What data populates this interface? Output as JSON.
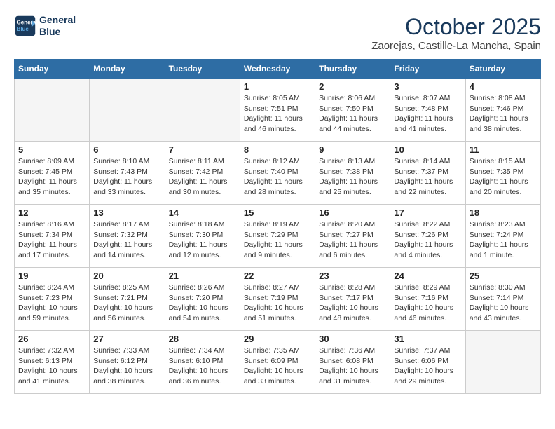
{
  "logo": {
    "line1": "General",
    "line2": "Blue"
  },
  "title": "October 2025",
  "subtitle": "Zaorejas, Castille-La Mancha, Spain",
  "weekdays": [
    "Sunday",
    "Monday",
    "Tuesday",
    "Wednesday",
    "Thursday",
    "Friday",
    "Saturday"
  ],
  "weeks": [
    [
      {
        "day": "",
        "info": ""
      },
      {
        "day": "",
        "info": ""
      },
      {
        "day": "",
        "info": ""
      },
      {
        "day": "1",
        "info": "Sunrise: 8:05 AM\nSunset: 7:51 PM\nDaylight: 11 hours and 46 minutes."
      },
      {
        "day": "2",
        "info": "Sunrise: 8:06 AM\nSunset: 7:50 PM\nDaylight: 11 hours and 44 minutes."
      },
      {
        "day": "3",
        "info": "Sunrise: 8:07 AM\nSunset: 7:48 PM\nDaylight: 11 hours and 41 minutes."
      },
      {
        "day": "4",
        "info": "Sunrise: 8:08 AM\nSunset: 7:46 PM\nDaylight: 11 hours and 38 minutes."
      }
    ],
    [
      {
        "day": "5",
        "info": "Sunrise: 8:09 AM\nSunset: 7:45 PM\nDaylight: 11 hours and 35 minutes."
      },
      {
        "day": "6",
        "info": "Sunrise: 8:10 AM\nSunset: 7:43 PM\nDaylight: 11 hours and 33 minutes."
      },
      {
        "day": "7",
        "info": "Sunrise: 8:11 AM\nSunset: 7:42 PM\nDaylight: 11 hours and 30 minutes."
      },
      {
        "day": "8",
        "info": "Sunrise: 8:12 AM\nSunset: 7:40 PM\nDaylight: 11 hours and 28 minutes."
      },
      {
        "day": "9",
        "info": "Sunrise: 8:13 AM\nSunset: 7:38 PM\nDaylight: 11 hours and 25 minutes."
      },
      {
        "day": "10",
        "info": "Sunrise: 8:14 AM\nSunset: 7:37 PM\nDaylight: 11 hours and 22 minutes."
      },
      {
        "day": "11",
        "info": "Sunrise: 8:15 AM\nSunset: 7:35 PM\nDaylight: 11 hours and 20 minutes."
      }
    ],
    [
      {
        "day": "12",
        "info": "Sunrise: 8:16 AM\nSunset: 7:34 PM\nDaylight: 11 hours and 17 minutes."
      },
      {
        "day": "13",
        "info": "Sunrise: 8:17 AM\nSunset: 7:32 PM\nDaylight: 11 hours and 14 minutes."
      },
      {
        "day": "14",
        "info": "Sunrise: 8:18 AM\nSunset: 7:30 PM\nDaylight: 11 hours and 12 minutes."
      },
      {
        "day": "15",
        "info": "Sunrise: 8:19 AM\nSunset: 7:29 PM\nDaylight: 11 hours and 9 minutes."
      },
      {
        "day": "16",
        "info": "Sunrise: 8:20 AM\nSunset: 7:27 PM\nDaylight: 11 hours and 6 minutes."
      },
      {
        "day": "17",
        "info": "Sunrise: 8:22 AM\nSunset: 7:26 PM\nDaylight: 11 hours and 4 minutes."
      },
      {
        "day": "18",
        "info": "Sunrise: 8:23 AM\nSunset: 7:24 PM\nDaylight: 11 hours and 1 minute."
      }
    ],
    [
      {
        "day": "19",
        "info": "Sunrise: 8:24 AM\nSunset: 7:23 PM\nDaylight: 10 hours and 59 minutes."
      },
      {
        "day": "20",
        "info": "Sunrise: 8:25 AM\nSunset: 7:21 PM\nDaylight: 10 hours and 56 minutes."
      },
      {
        "day": "21",
        "info": "Sunrise: 8:26 AM\nSunset: 7:20 PM\nDaylight: 10 hours and 54 minutes."
      },
      {
        "day": "22",
        "info": "Sunrise: 8:27 AM\nSunset: 7:19 PM\nDaylight: 10 hours and 51 minutes."
      },
      {
        "day": "23",
        "info": "Sunrise: 8:28 AM\nSunset: 7:17 PM\nDaylight: 10 hours and 48 minutes."
      },
      {
        "day": "24",
        "info": "Sunrise: 8:29 AM\nSunset: 7:16 PM\nDaylight: 10 hours and 46 minutes."
      },
      {
        "day": "25",
        "info": "Sunrise: 8:30 AM\nSunset: 7:14 PM\nDaylight: 10 hours and 43 minutes."
      }
    ],
    [
      {
        "day": "26",
        "info": "Sunrise: 7:32 AM\nSunset: 6:13 PM\nDaylight: 10 hours and 41 minutes."
      },
      {
        "day": "27",
        "info": "Sunrise: 7:33 AM\nSunset: 6:12 PM\nDaylight: 10 hours and 38 minutes."
      },
      {
        "day": "28",
        "info": "Sunrise: 7:34 AM\nSunset: 6:10 PM\nDaylight: 10 hours and 36 minutes."
      },
      {
        "day": "29",
        "info": "Sunrise: 7:35 AM\nSunset: 6:09 PM\nDaylight: 10 hours and 33 minutes."
      },
      {
        "day": "30",
        "info": "Sunrise: 7:36 AM\nSunset: 6:08 PM\nDaylight: 10 hours and 31 minutes."
      },
      {
        "day": "31",
        "info": "Sunrise: 7:37 AM\nSunset: 6:06 PM\nDaylight: 10 hours and 29 minutes."
      },
      {
        "day": "",
        "info": ""
      }
    ]
  ]
}
